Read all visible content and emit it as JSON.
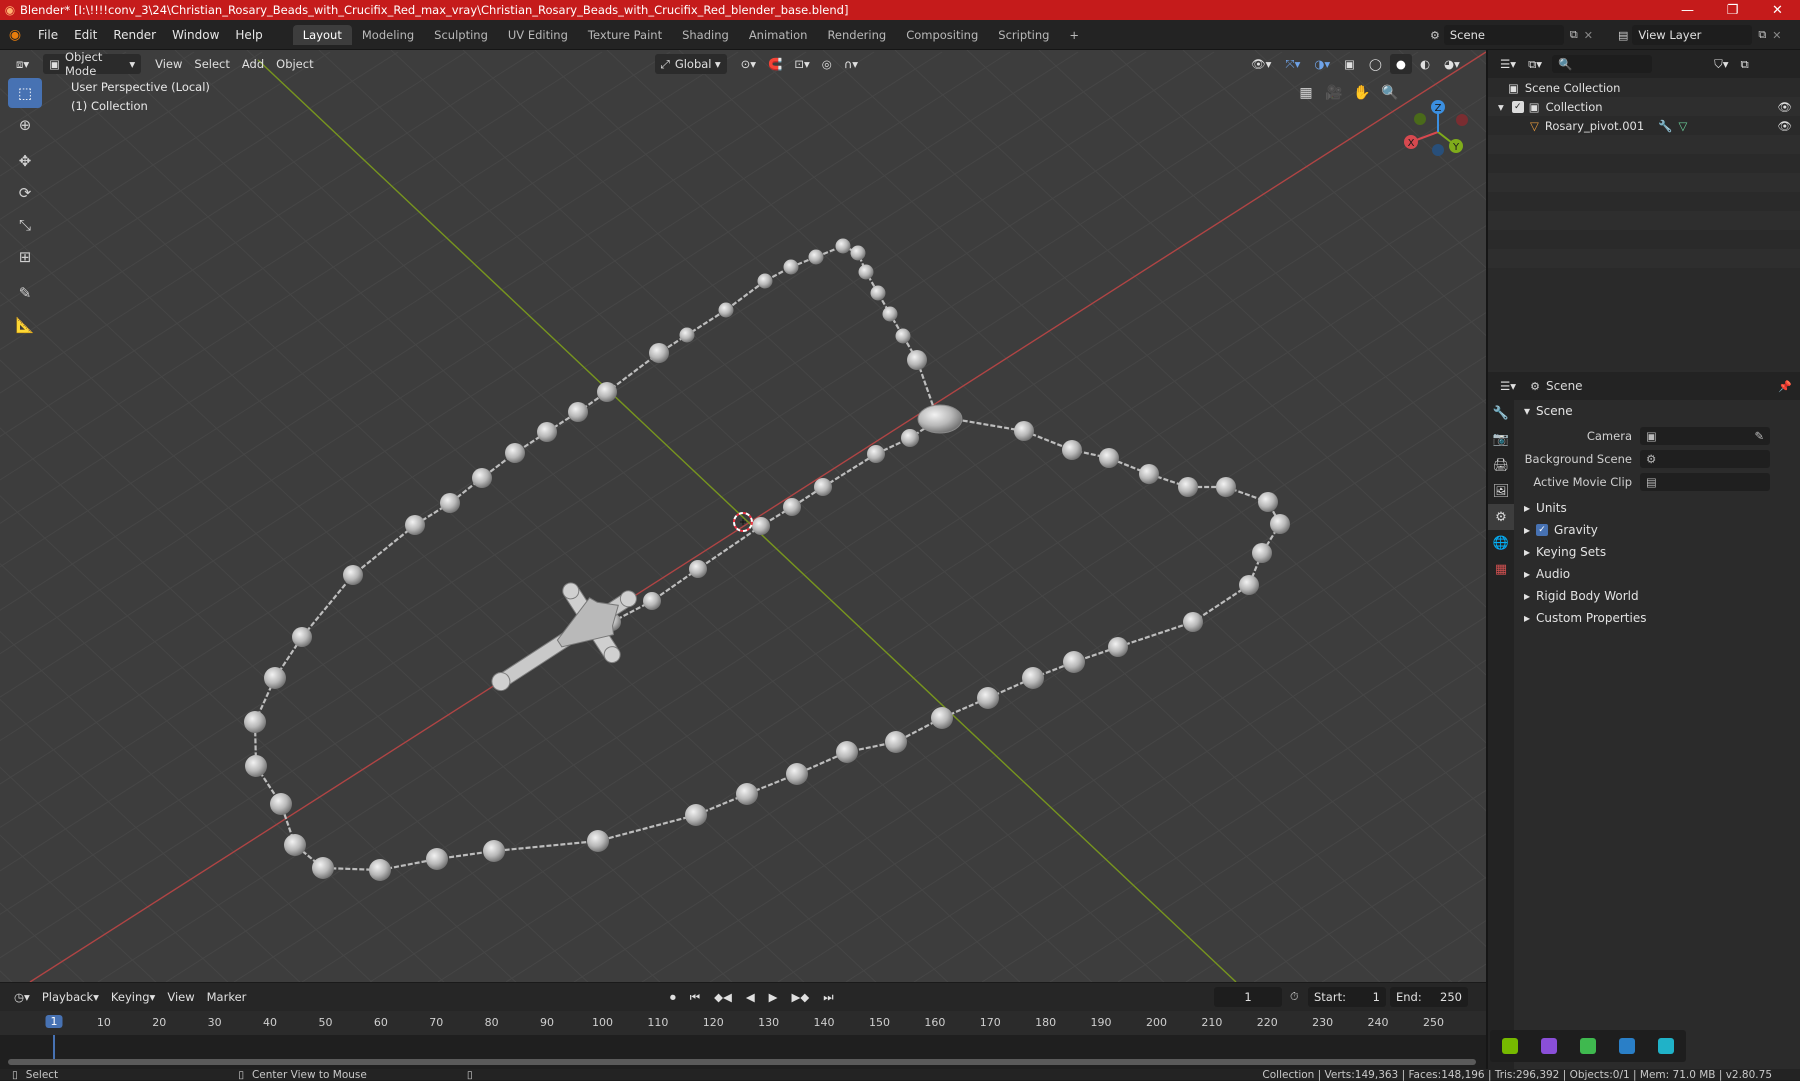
{
  "window": {
    "title": "Blender* [I:\\!!!!conv_3\\24\\Christian_Rosary_Beads_with_Crucifix_Red_max_vray\\Christian_Rosary_Beads_with_Crucifix_Red_blender_base.blend]",
    "minimize": "—",
    "maximize": "❐",
    "close": "✕"
  },
  "menu": [
    "File",
    "Edit",
    "Render",
    "Window",
    "Help"
  ],
  "workspaces": [
    "Layout",
    "Modeling",
    "Sculpting",
    "UV Editing",
    "Texture Paint",
    "Shading",
    "Animation",
    "Rendering",
    "Compositing",
    "Scripting"
  ],
  "add_workspace": "+",
  "scene_field": "Scene",
  "viewlayer_field": "View Layer",
  "viewport": {
    "mode": "Object Mode",
    "menus": [
      "View",
      "Select",
      "Add",
      "Object"
    ],
    "orientation": "Global",
    "info_line1": "User Perspective (Local)",
    "info_line2": "(1) Collection",
    "gizmo": {
      "x": "X",
      "y": "Y",
      "z": "Z"
    }
  },
  "outliner": {
    "search_placeholder": "",
    "scene_collection": "Scene Collection",
    "collection": "Collection",
    "object": "Rosary_pivot.001"
  },
  "properties": {
    "header": "Scene",
    "section": "Scene",
    "rows": [
      {
        "label": "Camera"
      },
      {
        "label": "Background Scene"
      },
      {
        "label": "Active Movie Clip"
      }
    ],
    "panels": [
      "Units",
      "Gravity",
      "Keying Sets",
      "Audio",
      "Rigid Body World",
      "Custom Properties"
    ]
  },
  "timeline": {
    "menus": [
      "Playback",
      "Keying",
      "View",
      "Marker"
    ],
    "current_frame": "1",
    "start_label": "Start:",
    "start": "1",
    "end_label": "End:",
    "end": "250",
    "ticks": [
      "1",
      "10",
      "20",
      "30",
      "40",
      "50",
      "60",
      "70",
      "80",
      "90",
      "100",
      "110",
      "120",
      "130",
      "140",
      "150",
      "160",
      "170",
      "180",
      "190",
      "200",
      "210",
      "220",
      "230",
      "240",
      "250"
    ]
  },
  "status": {
    "left": "Select",
    "mid": "Center View to Mouse",
    "right": "Collection | Verts:149,363 | Faces:148,196 | Tris:296,392 | Objects:0/1 | Mem: 71.0 MB | v2.80.75"
  },
  "colors": {
    "accent": "#4772b3",
    "titlebar": "#c51b1b",
    "x_axis": "#d7494f",
    "y_axis": "#7fac1b",
    "z_axis": "#3b8fe0"
  }
}
